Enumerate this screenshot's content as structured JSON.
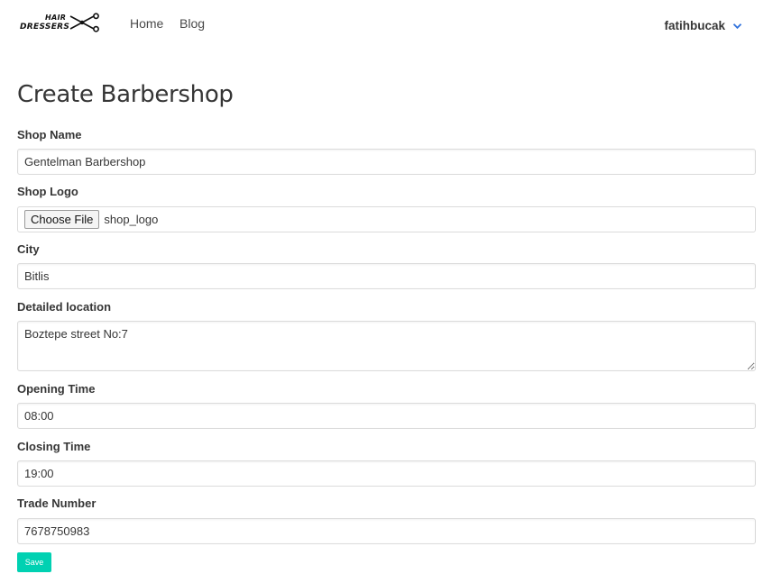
{
  "nav": {
    "logo_line1": "HAIR",
    "logo_line2": "DRESSERS",
    "links": [
      {
        "label": "Home"
      },
      {
        "label": "Blog"
      }
    ],
    "user": "fatihbucak"
  },
  "page": {
    "title": "Create Barbershop"
  },
  "form": {
    "shop_name": {
      "label": "Shop Name",
      "value": "Gentelman Barbershop"
    },
    "shop_logo": {
      "label": "Shop Logo",
      "button": "Choose File",
      "file_name": "shop_logo"
    },
    "city": {
      "label": "City",
      "value": "Bitlis"
    },
    "location": {
      "label": "Detailed location",
      "value": "Boztepe street No:7"
    },
    "opening_time": {
      "label": "Opening Time",
      "value": "08:00"
    },
    "closing_time": {
      "label": "Closing Time",
      "value": "19:00"
    },
    "trade_number": {
      "label": "Trade Number",
      "value": "7678750983"
    },
    "save_label": "Save"
  },
  "colors": {
    "primary": "#00d1b2",
    "dropdown_chevron": "#3273dc",
    "text": "#363636",
    "border": "#dbdbdb"
  }
}
